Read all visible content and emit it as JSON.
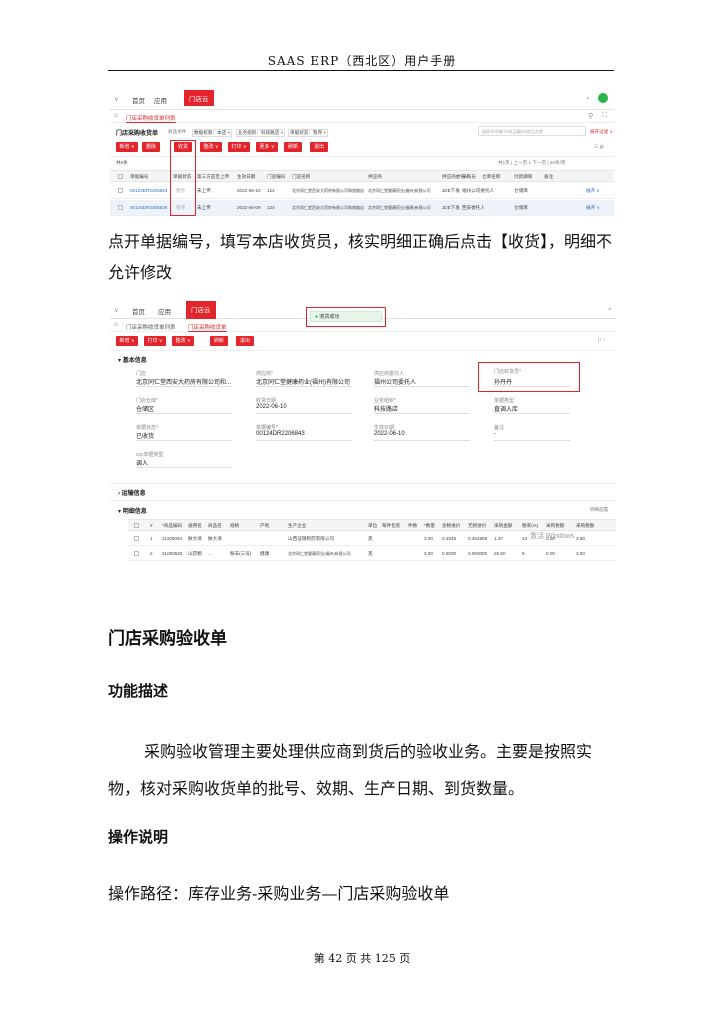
{
  "header": {
    "title": "SAAS ERP（西北区）用户手册"
  },
  "shot1": {
    "nav": {
      "home": "首页",
      "apps": "应用",
      "active": "门店云"
    },
    "subtab": "门店采购收货单列表",
    "list_title": "门店采购收货单",
    "filters": [
      "商品条件",
      "数据权限：本店 ×",
      "业务组织：科技路店 ×",
      "单据状态：暂存 ×"
    ],
    "search_placeholder": "搜索采购编号/商品编码/商品名称",
    "expand": "展开过滤 ∨",
    "buttons": [
      "新增 ∨",
      "删除",
      "收货",
      "整改 ∨",
      "打印 ∨",
      "更多 ∨",
      "刷新",
      "退出"
    ],
    "total": "共2条",
    "pager": "共1页 | 上一页 1 下一页 | 20条/页",
    "columns": [
      "单据编号",
      "单据状态",
      "第三方是否上传",
      "生效日期",
      "门店编码",
      "门店名称",
      "供应商",
      "供应商委托人",
      "采购员",
      "仓库名称",
      "付款期限",
      "备注"
    ],
    "rows": [
      [
        "00124DR2206843",
        "暂存",
        "未上传",
        "2022-06-10",
        "124",
        "北京同仁堂西安大药房有限公司和旅路店",
        "北京同仁堂健康药业(福州)有限公司",
        "JDE下发",
        "福州公司委托人",
        "仓储库",
        "",
        "展开 ∨"
      ],
      [
        "00124DR2206836",
        "暂存",
        "未上传",
        "2022-06-09",
        "124",
        "北京同仁堂西安大药房有限公司和旅路店",
        "北京同仁堂健康药业(福建)有限公司",
        "JDE下发",
        "西安委托人",
        "仓储库",
        "",
        "展开 ∨"
      ]
    ]
  },
  "para1": "点开单据编号，填写本店收货员，核实明细正确后点击【收货】，明细不允许修改",
  "shot2": {
    "nav": {
      "home": "首页",
      "apps": "应用",
      "active": "门店云"
    },
    "subtabs": [
      "门店采购收货单列表",
      "门店采购收货单"
    ],
    "toast": "收货成功",
    "buttons": [
      "新增 ∨",
      "打印 ∨",
      "整改 ∨",
      "刷新",
      "退出"
    ],
    "section_basic": "基本信息",
    "fields": [
      {
        "label": "门店",
        "value": "北京同仁堂西安大药房有限公司和..."
      },
      {
        "label": "供应商*",
        "value": "北京同仁堂健康药业(福州)有限公司"
      },
      {
        "label": "供应商委托人",
        "value": "福州公司委托人"
      },
      {
        "label": "门店收货员*",
        "value": "孙丹丹"
      },
      {
        "label": "门店仓库*",
        "value": "仓储区"
      },
      {
        "label": "收货日期",
        "value": "2022-06-10"
      },
      {
        "label": "业务组织*",
        "value": "科技路店"
      },
      {
        "label": "单据类型",
        "value": "直调入库"
      },
      {
        "label": "单据状态*",
        "value": "已收货"
      },
      {
        "label": "单据编号*",
        "value": "00124DR2206843"
      },
      {
        "label": "生效日期",
        "value": "2022-06-10"
      },
      {
        "label": "备注",
        "value": "-"
      },
      {
        "label": "ssc单据类型",
        "value": "调入"
      }
    ],
    "section_ship": "运输信息",
    "section_detail": "明细信息",
    "detail_config": "明细配置",
    "detail_cols": [
      "#",
      "*商品编码",
      "通用名",
      "商品名",
      "规格",
      "产地",
      "生产企业",
      "单位",
      "每件包装",
      "件数",
      "*数量",
      "含税进价",
      "无税进价",
      "采购金额",
      "税率(%)",
      "采购税额",
      "采购税额"
    ],
    "detail_rows": [
      [
        "1",
        "21100084",
        "肤大清",
        "肤大清",
        "",
        "",
        "山西证瑞制药有限公司",
        "克",
        "",
        "",
        "3.00",
        "0.4549",
        "0.454909",
        "1.37",
        "13",
        "0.00",
        "3.50"
      ],
      [
        "2",
        "21000632",
        "山药颗",
        "...",
        "粉末(三号)",
        "健康",
        "北京同仁堂健康药业(福州)有限公司",
        "克",
        "",
        "",
        "3.00",
        "0.9000",
        "0.900000",
        "26.50",
        "9",
        "0.00",
        "3.50"
      ]
    ],
    "watermark": "激活 Windows"
  },
  "section_title": "门店采购验收单",
  "func_title": "功能描述",
  "para2": "采购验收管理主要处理供应商到货后的验收业务。主要是按照实物，核对采购收货单的批号、效期、生产日期、到货数量。",
  "op_title": "操作说明",
  "para3": "操作路径：库存业务-采购业务—门店采购验收单",
  "footer": "第 42 页 共 125 页"
}
